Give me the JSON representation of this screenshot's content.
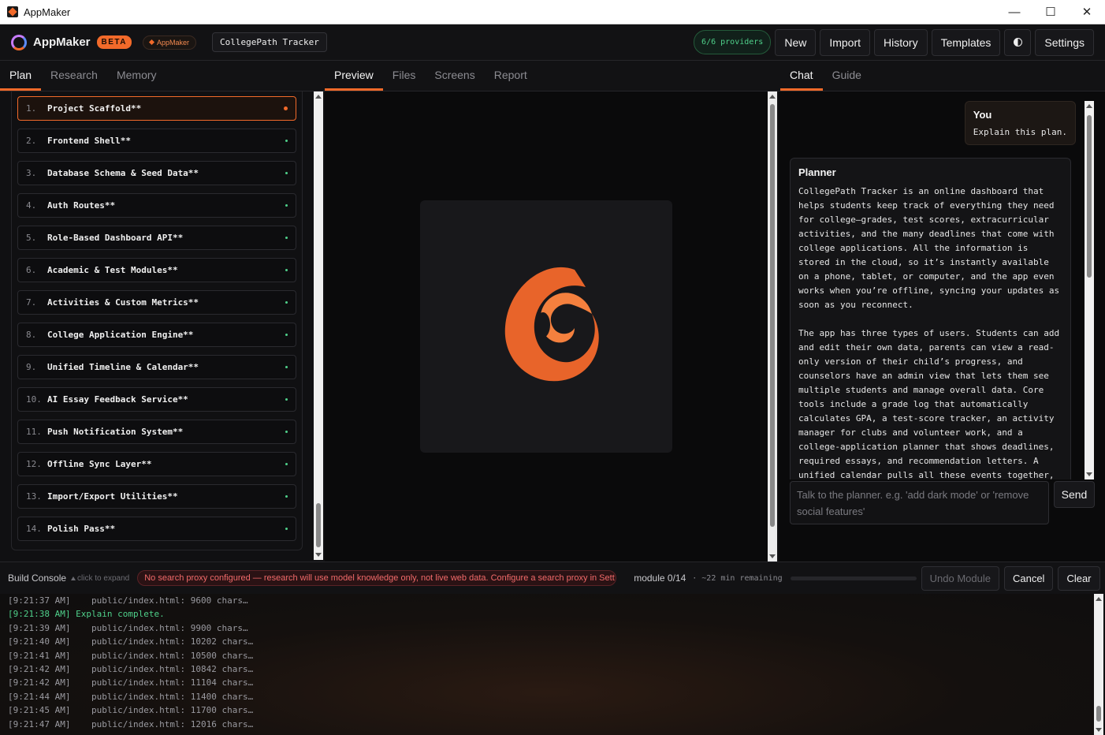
{
  "window": {
    "title": "AppMaker"
  },
  "header": {
    "brand": "AppMaker",
    "beta": "BETA",
    "app_pill": "AppMaker",
    "project": "CollegePath Tracker",
    "providers": "6/6 providers",
    "buttons": {
      "new": "New",
      "import": "Import",
      "history": "History",
      "templates": "Templates",
      "settings": "Settings"
    }
  },
  "left_tabs": [
    "Plan",
    "Research",
    "Memory"
  ],
  "center_tabs": [
    "Preview",
    "Files",
    "Screens",
    "Report"
  ],
  "right_tabs": [
    "Chat",
    "Guide"
  ],
  "plan": [
    {
      "num": "1.",
      "name": "Project Scaffold**"
    },
    {
      "num": "2.",
      "name": "Frontend Shell**"
    },
    {
      "num": "3.",
      "name": "Database Schema & Seed Data**"
    },
    {
      "num": "4.",
      "name": "Auth Routes**"
    },
    {
      "num": "5.",
      "name": "Role-Based Dashboard API**"
    },
    {
      "num": "6.",
      "name": "Academic & Test Modules**"
    },
    {
      "num": "7.",
      "name": "Activities & Custom Metrics**"
    },
    {
      "num": "8.",
      "name": "College Application Engine**"
    },
    {
      "num": "9.",
      "name": "Unified Timeline & Calendar**"
    },
    {
      "num": "10.",
      "name": "AI Essay Feedback Service**"
    },
    {
      "num": "11.",
      "name": "Push Notification System**"
    },
    {
      "num": "12.",
      "name": "Offline Sync Layer**"
    },
    {
      "num": "13.",
      "name": "Import/Export Utilities**"
    },
    {
      "num": "14.",
      "name": "Polish Pass**"
    }
  ],
  "chat": {
    "you_label": "You",
    "you_text": "Explain this plan.",
    "planner_label": "Planner",
    "planner_para1": "CollegePath Tracker is an online dashboard that helps students keep track of everything they need for college—grades, test scores, extracurricular activities, and the many deadlines that come with college applications. All the information is stored in the cloud, so it’s instantly available on a phone, tablet, or computer, and the app even works when you’re offline, syncing your updates as soon as you reconnect.",
    "planner_para2": "The app has three types of users. Students can add and edit their own data, parents can view a read-only version of their child’s progress, and counselors have an admin view that lets them see multiple students and manage overall data. Core tools include a grade log that automatically calculates GPA, a test-score tracker, an activity manager for clubs and volunteer work, and a college-application planner that shows deadlines, required essays, and recommendation letters. A unified calendar pulls all these events together,",
    "input_placeholder": "Talk to the planner. e.g. 'add dark mode' or 'remove social features'",
    "send": "Send"
  },
  "console": {
    "title": "Build Console",
    "hint": "click to expand",
    "warning": "No search proxy configured — research will use model knowledge only, not live web data. Configure a search proxy in Sett",
    "module": "module 0/14",
    "remaining": "· ~22 min remaining",
    "progress": 0.5,
    "undo": "Undo Module",
    "cancel": "Cancel",
    "clear": "Clear",
    "logs": [
      {
        "time": "[9:21:37 AM]",
        "text": "    public/index.html: 9600 chars…",
        "ok": false
      },
      {
        "time": "[9:21:38 AM]",
        "text": " Explain complete.",
        "ok": true
      },
      {
        "time": "[9:21:39 AM]",
        "text": "    public/index.html: 9900 chars…",
        "ok": false
      },
      {
        "time": "[9:21:40 AM]",
        "text": "    public/index.html: 10202 chars…",
        "ok": false
      },
      {
        "time": "[9:21:41 AM]",
        "text": "    public/index.html: 10500 chars…",
        "ok": false
      },
      {
        "time": "[9:21:42 AM]",
        "text": "    public/index.html: 10842 chars…",
        "ok": false
      },
      {
        "time": "[9:21:42 AM]",
        "text": "    public/index.html: 11104 chars…",
        "ok": false
      },
      {
        "time": "[9:21:44 AM]",
        "text": "    public/index.html: 11400 chars…",
        "ok": false
      },
      {
        "time": "[9:21:45 AM]",
        "text": "    public/index.html: 11700 chars…",
        "ok": false
      },
      {
        "time": "[9:21:47 AM]",
        "text": "    public/index.html: 12016 chars…",
        "ok": false
      }
    ]
  },
  "colors": {
    "accent": "#f26a2a",
    "success": "#4fd08a",
    "danger": "#f26a6a"
  }
}
